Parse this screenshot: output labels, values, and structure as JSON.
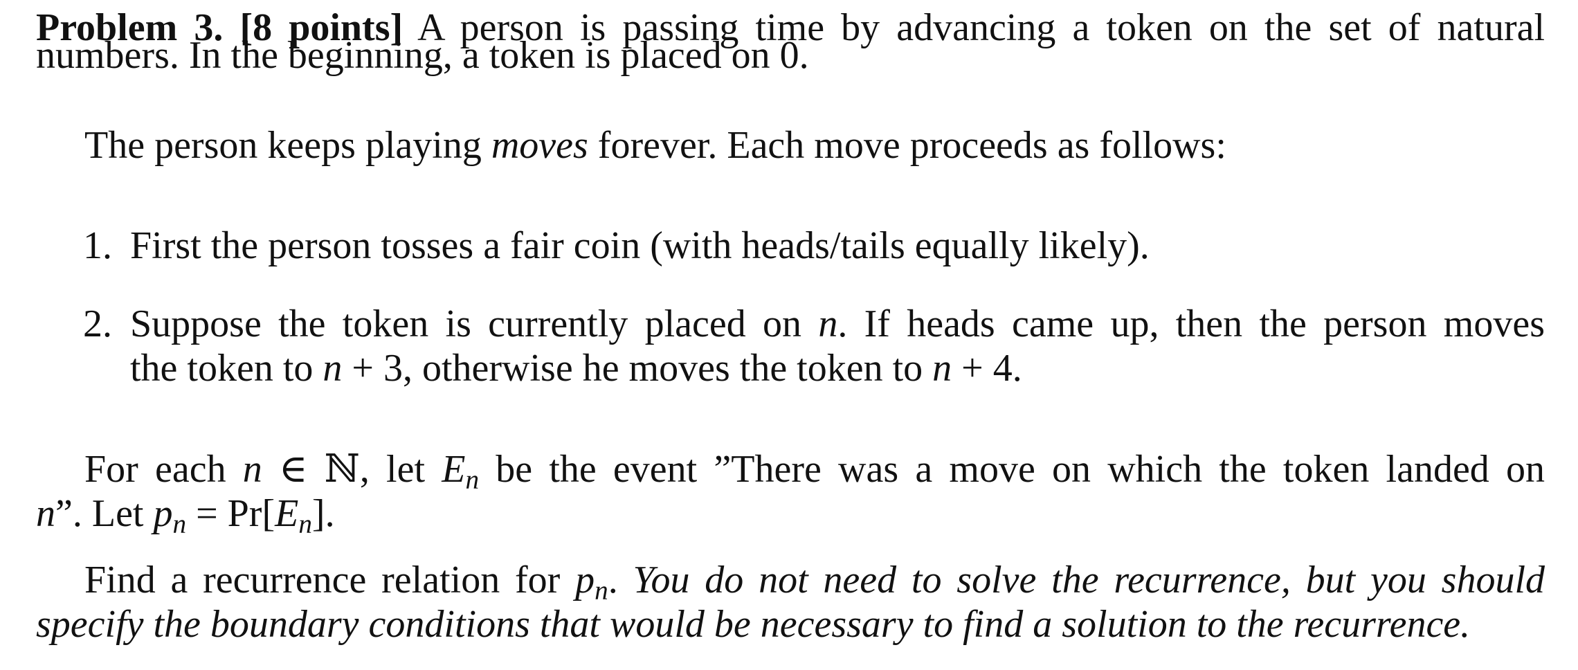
{
  "problem": {
    "heading": "Problem 3.",
    "points": "[8 points]",
    "intro_line1_rest": "A person is passing time by advancing a token on the set of natural",
    "intro_line2": "numbers. In the beginning, a token is placed on ",
    "intro_zero": "0",
    "intro_period": "."
  },
  "moves": {
    "before": "The person keeps playing ",
    "moves_word": "moves",
    "after": " forever. Each move proceeds as follows:"
  },
  "items": [
    {
      "number": "1.",
      "line1": "First the person tosses a fair coin (with heads/tails equally likely)."
    },
    {
      "number": "2.",
      "line1_a": "Suppose the token is currently placed on ",
      "line1_n": "n",
      "line1_b": ". If heads came up, then the person moves",
      "line2_a": "the token to ",
      "line2_m1": "n",
      "line2_p1": " + 3",
      "line2_b": ", otherwise he moves the token to ",
      "line2_m2": "n",
      "line2_p2": " + 4",
      "line2_c": "."
    }
  ],
  "event": {
    "line1_a": "For each ",
    "line1_n": "n",
    "line1_in": " ∈ ℕ",
    "line1_b": ", let ",
    "line1_E": "E",
    "line1_sub": "n",
    "line1_c": " be the event ”There was a move on which the token landed on",
    "line2_n": "n",
    "line2_a": "”. Let ",
    "line2_p": "p",
    "line2_psub": "n",
    "line2_eq": " = Pr[",
    "line2_E": "E",
    "line2_Esub": "n",
    "line2_close": "]."
  },
  "task": {
    "line1_a": "Find a recurrence relation for ",
    "line1_p": "p",
    "line1_psub": "n",
    "line1_b": ". ",
    "line1_it": "You do not need to solve the recurrence, but you should",
    "line2_it": "specify the boundary conditions that would be necessary to find a solution to the recurrence."
  }
}
